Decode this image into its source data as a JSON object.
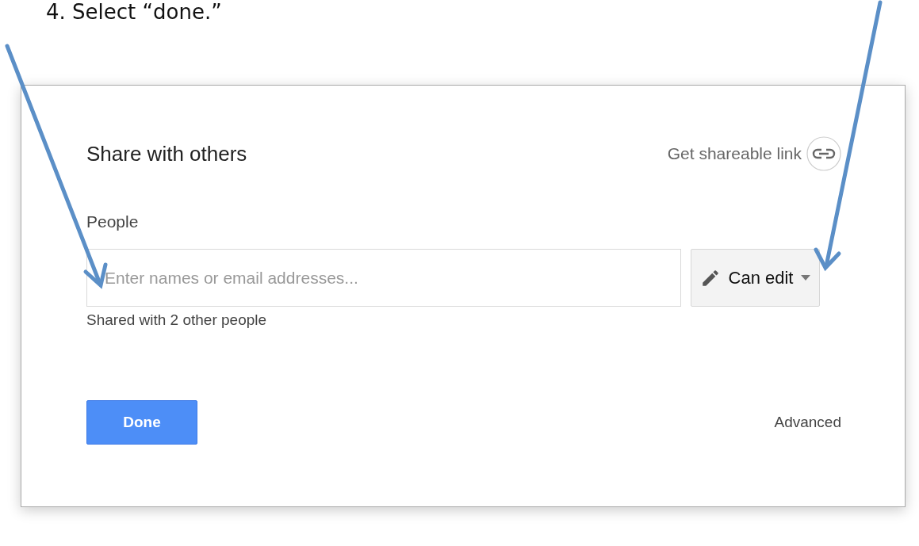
{
  "instruction": "4. Select “done.”",
  "dialog": {
    "title": "Share with others",
    "link_action": "Get shareable link",
    "people_label": "People",
    "people_field": {
      "placeholder": "Enter names or email addresses..."
    },
    "permission": "Can edit",
    "shared_note": "Shared with 2 other people",
    "buttons": [
      {
        "label": "Done",
        "kind": "primary"
      },
      {
        "label": "Advanced",
        "kind": "link"
      }
    ]
  }
}
